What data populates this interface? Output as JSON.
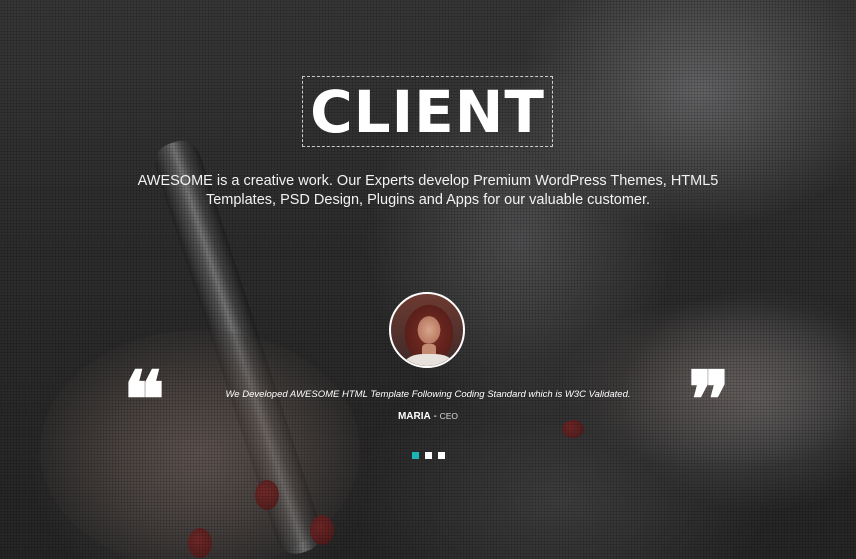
{
  "hero": {
    "title": "CLIENT",
    "description": "AWESOME is a creative work. Our Experts develop Premium WordPress Themes, HTML5 Templates, PSD Design, Plugins and Apps for our valuable customer."
  },
  "testimonial": {
    "quote": "We Developed AWESOME HTML Template Following Coding Standard which is W3C Validated.",
    "author_name": "MARIA",
    "separator": " - ",
    "author_role": "CEO",
    "open_quote": "❝",
    "close_quote": "❞"
  },
  "carousel": {
    "slide_count": 3,
    "active_index": 0,
    "active_color": "#1ab5b5"
  },
  "icons": {
    "left_quote": "left-quote-icon",
    "right_quote": "right-quote-icon"
  }
}
